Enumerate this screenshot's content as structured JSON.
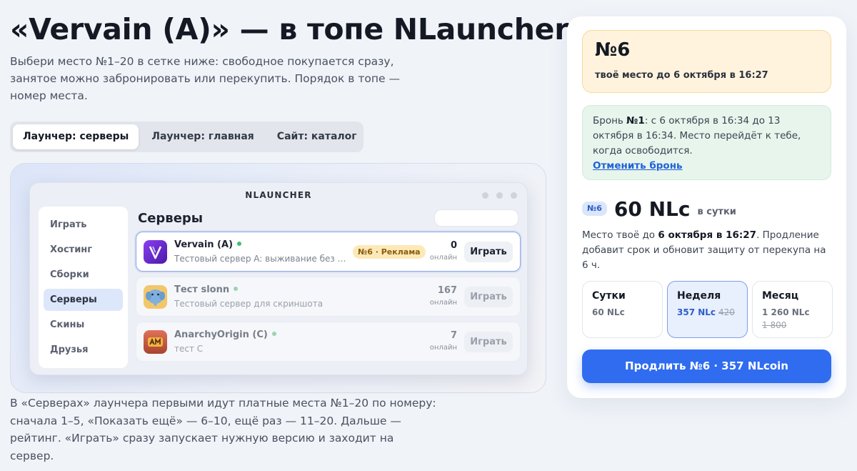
{
  "hero": {
    "title": "«Vervain (A)» — в топе NLauncher",
    "lead": "Выбери место №1–20 в сетке ниже: свободное покупается сразу, занятое можно забронировать или перекупить. Порядок в топе — номер места."
  },
  "tabs": [
    {
      "label": "Лаунчер: серверы",
      "active": true
    },
    {
      "label": "Лаунчер: главная",
      "active": false
    },
    {
      "label": "Сайт: каталог",
      "active": false
    }
  ],
  "preview": {
    "window_title": "NLAUNCHER",
    "sidebar": [
      {
        "label": "Играть",
        "active": false
      },
      {
        "label": "Хостинг",
        "active": false
      },
      {
        "label": "Сборки",
        "active": false
      },
      {
        "label": "Серверы",
        "active": true
      },
      {
        "label": "Скины",
        "active": false
      },
      {
        "label": "Друзья",
        "active": false
      }
    ],
    "section_title": "Серверы",
    "servers": [
      {
        "name": "Vervain (A)",
        "desc": "Тестовый сервер A: выживание без вайпа",
        "badge": "№6 · Реклама",
        "count": "0",
        "count_label": "онлайн",
        "play_label": "Играть",
        "logo_icon": "vervain-logo-icon"
      },
      {
        "name": "Тест slonn",
        "desc": "Тестовый сервер для скриншота",
        "count": "167",
        "count_label": "онлайн",
        "play_label": "Играть",
        "logo_icon": "elephant-logo-icon"
      },
      {
        "name": "AnarchyOrigin (C)",
        "desc": "тест С",
        "count": "7",
        "count_label": "онлайн",
        "play_label": "Играть",
        "logo_icon": "anarchy-logo-icon"
      }
    ]
  },
  "footer_text": "В «Серверах» лаунчера первыми идут платные места №1–20 по номеру: сначала 1–5, «Показать ещё» — 6–10, ещё раз — 11–20. Дальше — рейтинг. «Играть» сразу запускает нужную версию и заходит на сервер.",
  "card": {
    "spot_number": "№6",
    "spot_until": "твоё место до 6 октября в 16:27",
    "booking": {
      "prefix": "Бронь ",
      "num": "№1",
      "text": ": с 6 октября в 16:34 до 13 октября в 16:34. Место перейдёт к тебе, когда освободится.",
      "cancel_label": "Отменить бронь"
    },
    "price_pill": "№6",
    "price": "60 NLc",
    "per": "в сутки",
    "info": {
      "t1": "Место твоё до ",
      "date": "6 октября в 16:27",
      "t2": ". Продление добавит срок и обновит защиту от перекупа на 6 ч."
    },
    "periods": [
      {
        "name": "Сутки",
        "price": "60 NLc",
        "old": "",
        "active": false
      },
      {
        "name": "Неделя",
        "price": "357 NLc",
        "old": "420",
        "active": true
      },
      {
        "name": "Месяц",
        "price": "1 260 NLc",
        "old": "1 800",
        "active": false
      }
    ],
    "cta_label": "Продлить №6 · 357 NLcoin"
  },
  "colors": {
    "accent": "#2f6cf0",
    "spot_bg": "#fff3dd",
    "booking_bg": "#e7f5ec",
    "badge_bg": "#fde9b8"
  }
}
